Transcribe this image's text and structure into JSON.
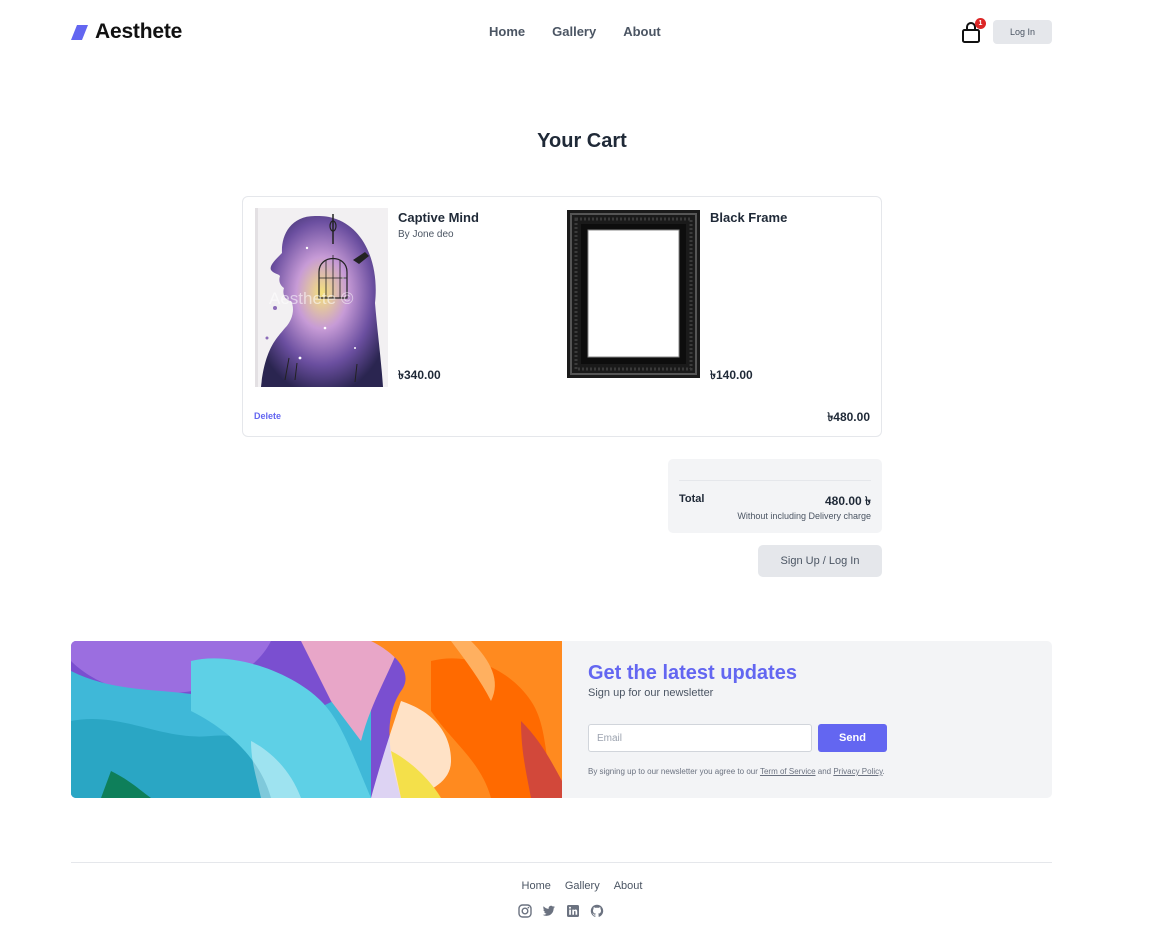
{
  "header": {
    "brand": "Aesthete",
    "nav": [
      "Home",
      "Gallery",
      "About"
    ],
    "cart_count": "1",
    "login_label": "Log In"
  },
  "page_title": "Your Cart",
  "cart": {
    "items": [
      {
        "name": "Captive Mind",
        "artist": "By Jone deo",
        "price": "৳340.00"
      },
      {
        "name": "Black Frame",
        "artist": "",
        "price": "৳140.00"
      }
    ],
    "delete_label": "Delete",
    "subtotal": "৳480.00"
  },
  "total": {
    "label": "Total",
    "amount": "480.00 ৳",
    "note": "Without including Delivery charge"
  },
  "signup_button": "Sign Up / Log In",
  "newsletter": {
    "title": "Get the latest updates",
    "subtitle": "Sign up for our newsletter",
    "email_placeholder": "Email",
    "send_label": "Send",
    "legal_prefix": "By signing up to our newsletter you agree to our ",
    "terms_label": "Term of Service",
    "legal_and": " and ",
    "privacy_label": "Privacy Policy",
    "legal_suffix": "."
  },
  "footer": {
    "nav": [
      "Home",
      "Gallery",
      "About"
    ],
    "social_icons": [
      "instagram-icon",
      "twitter-icon",
      "linkedin-icon",
      "github-icon"
    ]
  },
  "colors": {
    "accent": "#6366f1",
    "badge": "#dc2626",
    "muted_bg": "#f3f4f6"
  }
}
